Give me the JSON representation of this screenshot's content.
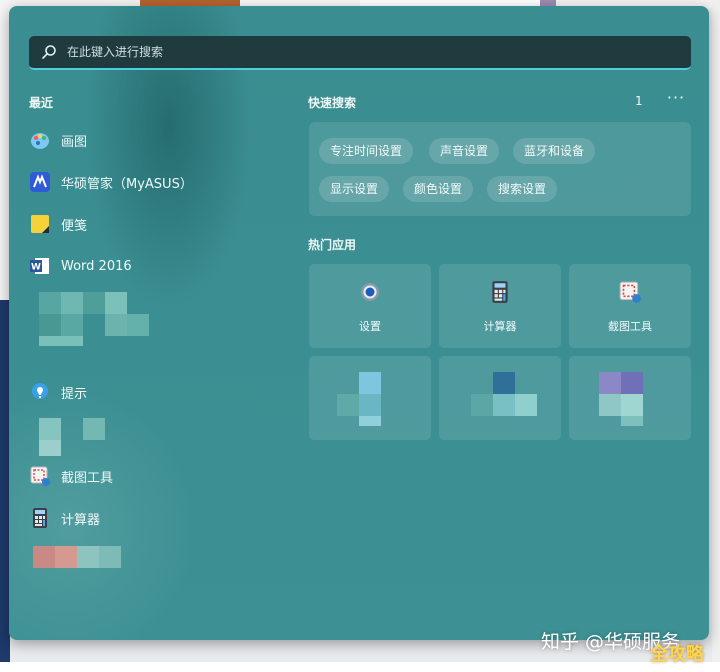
{
  "search": {
    "placeholder": "在此键入进行搜索"
  },
  "recent": {
    "title": "最近",
    "items": [
      {
        "label": "画图",
        "icon": "paint-icon"
      },
      {
        "label": "华硕管家（MyASUS）",
        "icon": "myasus-icon"
      },
      {
        "label": "便笺",
        "icon": "sticky-notes-icon"
      },
      {
        "label": "Word 2016",
        "icon": "word-icon"
      },
      {
        "label": "提示",
        "icon": "tips-icon"
      },
      {
        "label": "截图工具",
        "icon": "snipping-tool-icon"
      },
      {
        "label": "计算器",
        "icon": "calculator-icon"
      }
    ]
  },
  "quick_search": {
    "title": "快速搜索",
    "count": "1",
    "more": "···",
    "chips": [
      "专注时间设置",
      "声音设置",
      "蓝牙和设备",
      "显示设置",
      "颜色设置",
      "搜索设置"
    ]
  },
  "top_apps": {
    "title": "热门应用",
    "tiles": [
      {
        "label": "设置",
        "icon": "settings-gear-icon"
      },
      {
        "label": "计算器",
        "icon": "calculator-icon"
      },
      {
        "label": "截图工具",
        "icon": "snipping-tool-icon"
      }
    ]
  },
  "watermark": {
    "text": "知乎 @华硕服务",
    "overlay": "全攻略"
  }
}
